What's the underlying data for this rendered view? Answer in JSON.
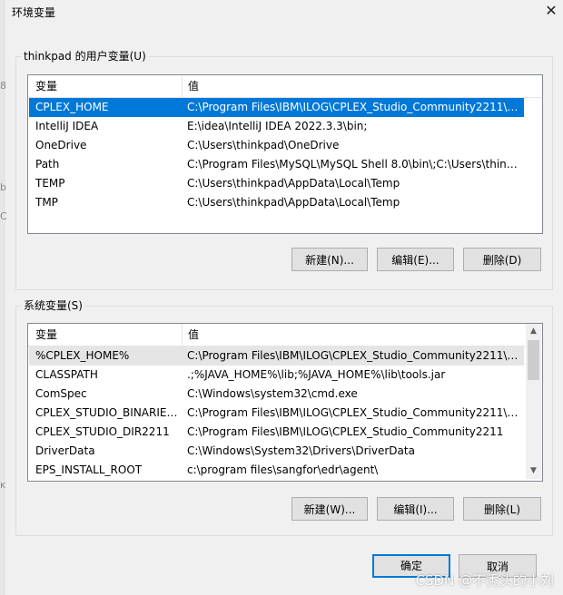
{
  "window": {
    "title": "环境变量",
    "close_glyph": "✕"
  },
  "user_vars": {
    "label": "thinkpad 的用户变量(U)",
    "col_name": "变量",
    "col_value": "值",
    "rows": [
      {
        "name": "CPLEX_HOME",
        "value": "C:\\Program Files\\IBM\\ILOG\\CPLEX_Studio_Community2211\\c..."
      },
      {
        "name": "IntelliJ IDEA",
        "value": "E:\\idea\\IntelliJ IDEA 2022.3.3\\bin;"
      },
      {
        "name": "OneDrive",
        "value": "C:\\Users\\thinkpad\\OneDrive"
      },
      {
        "name": "Path",
        "value": "C:\\Program Files\\MySQL\\MySQL Shell 8.0\\bin\\;C:\\Users\\think..."
      },
      {
        "name": "TEMP",
        "value": "C:\\Users\\thinkpad\\AppData\\Local\\Temp"
      },
      {
        "name": "TMP",
        "value": "C:\\Users\\thinkpad\\AppData\\Local\\Temp"
      }
    ],
    "new_label": "新建(N)...",
    "edit_label": "编辑(E)...",
    "delete_label": "删除(D)"
  },
  "system_vars": {
    "label": "系统变量(S)",
    "col_name": "变量",
    "col_value": "值",
    "rows": [
      {
        "name": "%CPLEX_HOME%",
        "value": "C:\\Program Files\\IBM\\ILOG\\CPLEX_Studio_Community2211\\c..."
      },
      {
        "name": "CLASSPATH",
        "value": ".;%JAVA_HOME%\\lib;%JAVA_HOME%\\lib\\tools.jar"
      },
      {
        "name": "ComSpec",
        "value": "C:\\Windows\\system32\\cmd.exe"
      },
      {
        "name": "CPLEX_STUDIO_BINARIES...",
        "value": "C:\\Program Files\\IBM\\ILOG\\CPLEX_Studio_Community2211\\o..."
      },
      {
        "name": "CPLEX_STUDIO_DIR2211",
        "value": "C:\\Program Files\\IBM\\ILOG\\CPLEX_Studio_Community2211"
      },
      {
        "name": "DriverData",
        "value": "C:\\Windows\\System32\\Drivers\\DriverData"
      },
      {
        "name": "EPS_INSTALL_ROOT",
        "value": "c:\\program files\\sangfor\\edr\\agent\\"
      }
    ],
    "new_label": "新建(W)...",
    "edit_label": "编辑(I)...",
    "delete_label": "删除(L)"
  },
  "footer": {
    "ok_label": "确定",
    "cancel_label": "取消"
  },
  "watermark": "CSDN @不秃头的小刘",
  "edge_glyphs": [
    "8",
    "b",
    "C",
    "ĸ"
  ],
  "colors": {
    "selection": "#0078d7",
    "button": "#e1e1e1",
    "focus_border": "#0078d7"
  }
}
